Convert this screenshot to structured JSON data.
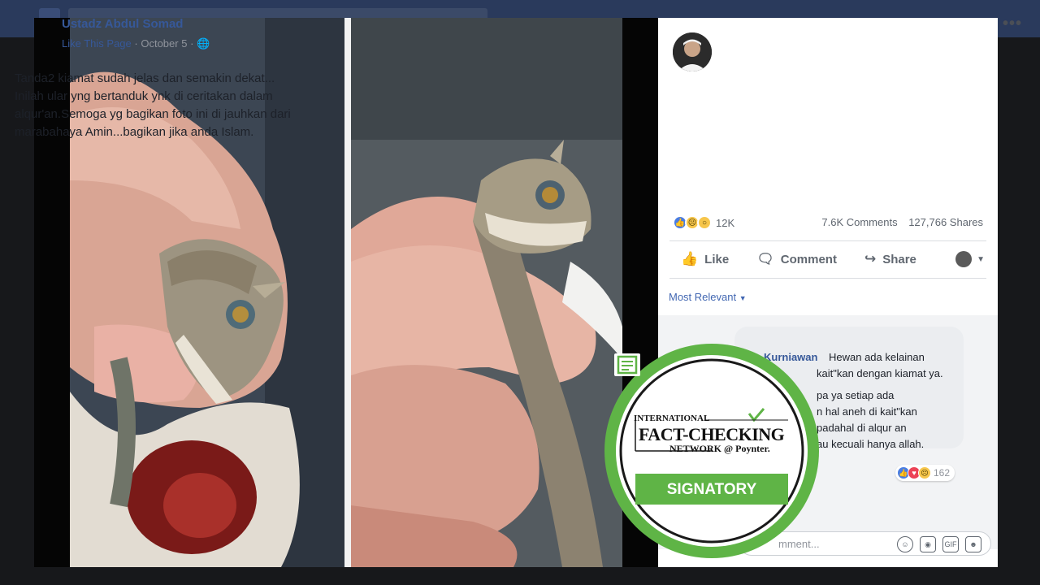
{
  "post": {
    "author": "Ustadz Abdul Somad",
    "like_page": "Like This Page",
    "date": "October 5",
    "globe_icon": "globe-icon",
    "more": "•••",
    "text_line1": "Tanda2 kiamat sudah jelas dan semakin dekat...",
    "text_line2": "Inilah ular yng bertanduk ynk di ceritakan dalam",
    "text_line3": "alqur'an.Semoga yg bagikan foto ini di jauhkan dari",
    "text_line4": "marabahaya Amin...bagikan jika anda Islam."
  },
  "stats": {
    "reactions": "12K",
    "comments": "7.6K Comments",
    "shares": "127,766 Shares"
  },
  "actions": {
    "like": "Like",
    "comment": "Comment",
    "share": "Share"
  },
  "comments": {
    "filter": "Most Relevant",
    "c1_name": "Kurniawan",
    "c1_text": "Hewan ada kelainan",
    "c1_cont": "kait\"kan dengan kiamat ya.",
    "c2_line1": "pa ya setiap ada",
    "c2_line2": "n hal aneh di kait\"kan",
    "c2_line3": "padahal di alqur an",
    "c2_line4": "au kecuali hanya allah.",
    "c2_reactions": "162",
    "write_placeholder": "mment..."
  },
  "badge": {
    "line1": "INTERNATIONAL",
    "line2": "FACT-CHECKING",
    "line3": "NETWORK @ Poynter.",
    "band": "SIGNATORY"
  },
  "colors": {
    "fb_blue": "#365899",
    "badge_green": "#5fb446"
  }
}
